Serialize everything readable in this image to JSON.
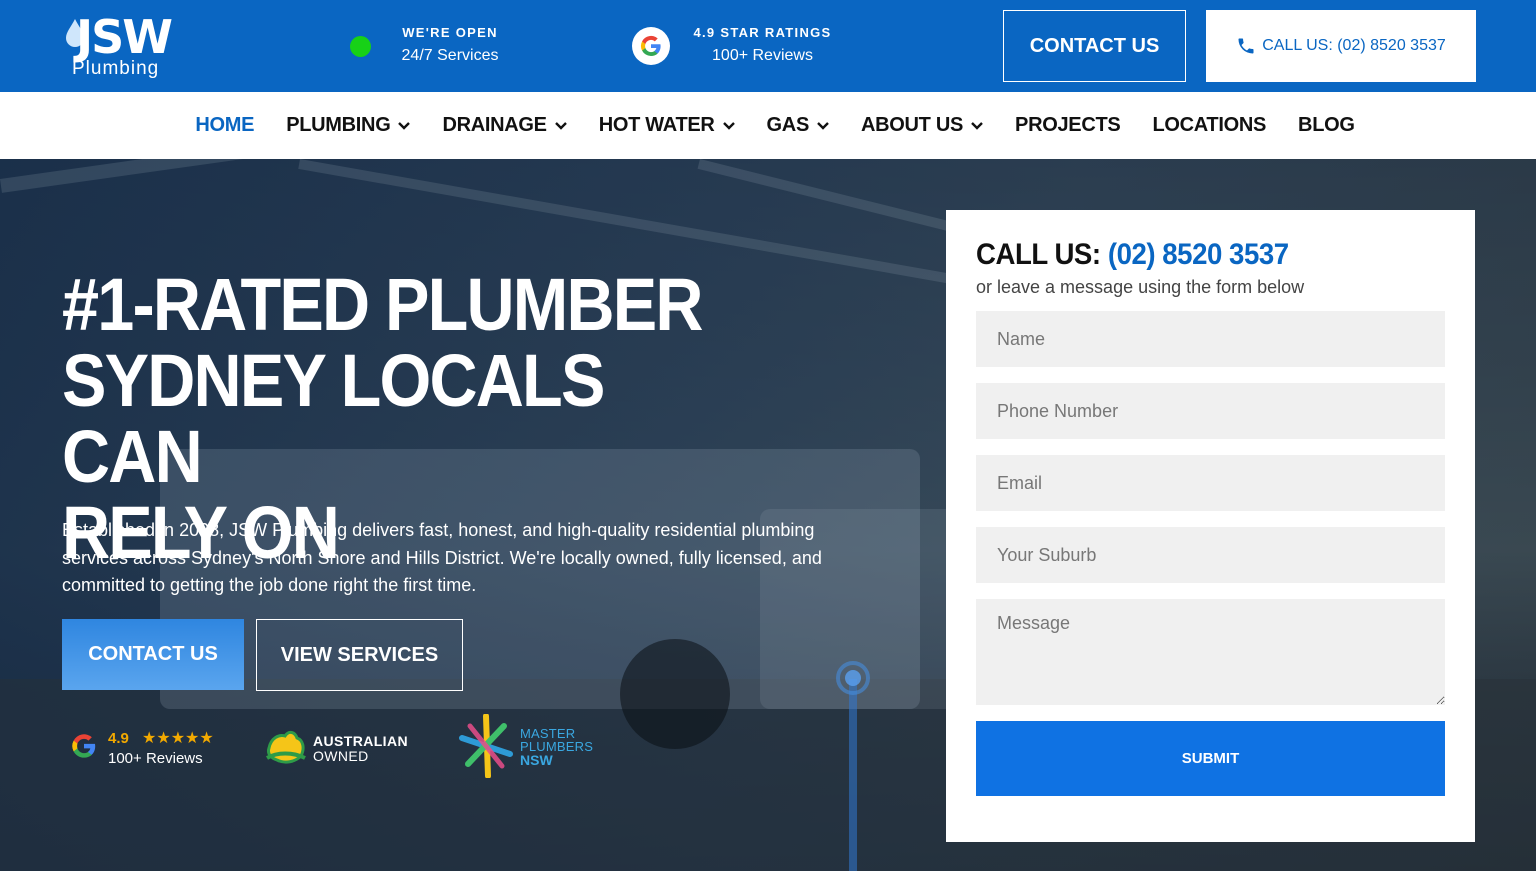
{
  "brand": {
    "name": "JSW",
    "sub": "Plumbing"
  },
  "topbar": {
    "open_title": "WE'RE OPEN",
    "open_sub": "24/7 Services",
    "rating_title": "4.9 STAR RATINGS",
    "rating_sub": "100+ Reviews",
    "contact_label": "CONTACT US",
    "call_label": "CALL US: (02) 8520 3537",
    "status_color": "#17d117",
    "accent": "#0a66c2"
  },
  "nav": {
    "items": [
      {
        "label": "HOME",
        "dropdown": false,
        "active": true
      },
      {
        "label": "PLUMBING",
        "dropdown": true
      },
      {
        "label": "DRAINAGE",
        "dropdown": true
      },
      {
        "label": "HOT WATER",
        "dropdown": true
      },
      {
        "label": "GAS",
        "dropdown": true
      },
      {
        "label": "ABOUT US",
        "dropdown": true
      },
      {
        "label": "PROJECTS",
        "dropdown": false
      },
      {
        "label": "LOCATIONS",
        "dropdown": false
      },
      {
        "label": "BLOG",
        "dropdown": false
      }
    ]
  },
  "hero": {
    "headline_1": "#1-RATED PLUMBER",
    "headline_2": "SYDNEY LOCALS CAN",
    "headline_3": "RELY ON",
    "lede": "Established in 2008, JSW Plumbing delivers fast, honest, and high-quality residential plumbing services across Sydney's North Shore and Hills District. We're locally owned, fully licensed, and committed to getting the job done right the first time.",
    "cta_primary": "CONTACT US",
    "cta_secondary": "VIEW SERVICES"
  },
  "badges": {
    "google_rating": "4.9",
    "google_stars": "★★★★★",
    "google_reviews": "100+ Reviews",
    "aus_line1": "AUSTRALIAN",
    "aus_line2": "OWNED",
    "mp_line1": "MASTER",
    "mp_line2": "PLUMBERS",
    "mp_line3": "NSW"
  },
  "form": {
    "heading_label": "CALL US:",
    "heading_number": "(02) 8520 3537",
    "subheading": "or leave a message using the form below",
    "name_placeholder": "Name",
    "phone_placeholder": "Phone Number",
    "email_placeholder": "Email",
    "suburb_placeholder": "Your Suburb",
    "message_placeholder": "Message",
    "submit_label": "SUBMIT"
  }
}
